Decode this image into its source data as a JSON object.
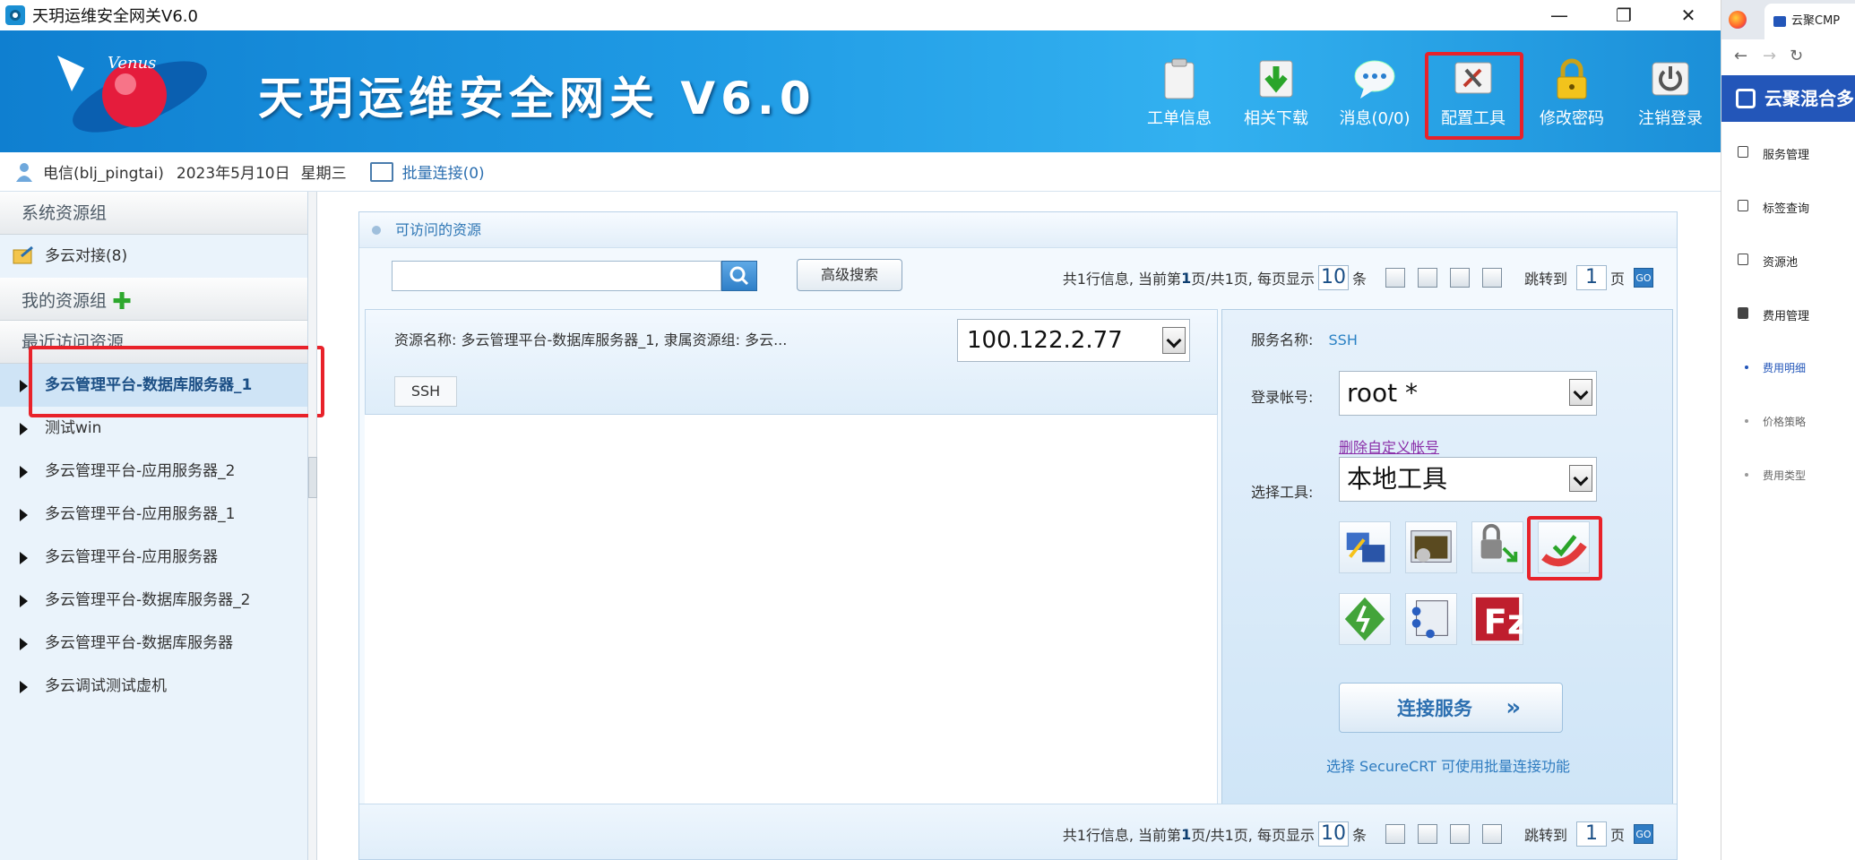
{
  "window": {
    "title": "天玥运维安全网关V6.0",
    "minimize": "—",
    "maximize": "❐",
    "close": "✕"
  },
  "banner": {
    "logo_text": "Venus",
    "headline": "天玥运维安全网关 V6.0",
    "tools": [
      {
        "label": "工单信息"
      },
      {
        "label": "相关下载"
      },
      {
        "label": "消息(0/0)"
      },
      {
        "label": "配置工具"
      },
      {
        "label": "修改密码"
      },
      {
        "label": "注销登录"
      }
    ]
  },
  "userbar": {
    "user": "电信(blj_pingtai)",
    "date": "2023年5月10日",
    "weekday": "星期三",
    "batch_connect": "批量连接(0)"
  },
  "sidebar": {
    "group_system": "系统资源组",
    "multicloud": "多云对接(8)",
    "group_mine": "我的资源组",
    "group_recent": "最近访问资源",
    "items": [
      {
        "label": "多云管理平台-数据库服务器_1"
      },
      {
        "label": "测试win"
      },
      {
        "label": "多云管理平台-应用服务器_2"
      },
      {
        "label": "多云管理平台-应用服务器_1"
      },
      {
        "label": "多云管理平台-应用服务器"
      },
      {
        "label": "多云管理平台-数据库服务器_2"
      },
      {
        "label": "多云管理平台-数据库服务器"
      },
      {
        "label": "多云调试测试虚机"
      }
    ]
  },
  "main": {
    "title": "可访问的资源",
    "advanced_search": "高级搜索",
    "pager": {
      "prefix": "共1行信息, 当前第",
      "page_current": "1",
      "mid": "页/共1页, 每页显示",
      "per_page": "10",
      "unit": "条",
      "jump_to": "跳转到",
      "jump_value": "1",
      "page_word": "页",
      "go": "GO"
    },
    "resource": {
      "name_line": "资源名称: 多云管理平台-数据库服务器_1, 隶属资源组: 多云...",
      "ip": "100.122.2.77",
      "protocol": "SSH"
    },
    "service": {
      "name_label": "服务名称:",
      "name_value": "SSH",
      "account_label": "登录帐号:",
      "account_value": "root *",
      "delete_custom": "删除自定义帐号",
      "tool_label": "选择工具:",
      "tool_value": "本地工具",
      "connect": "连接服务",
      "connect_arrows": "»",
      "hint": "选择 SecureCRT 可使用批量连接功能"
    }
  },
  "right_browser": {
    "tab_title": "云聚CMP",
    "brand": "云聚混合多",
    "menu": [
      {
        "label": "服务管理"
      },
      {
        "label": "标签查询"
      },
      {
        "label": "资源池"
      },
      {
        "label": "费用管理"
      }
    ],
    "submenu": [
      {
        "label": "费用明细"
      },
      {
        "label": "价格策略"
      },
      {
        "label": "费用类型"
      }
    ]
  }
}
